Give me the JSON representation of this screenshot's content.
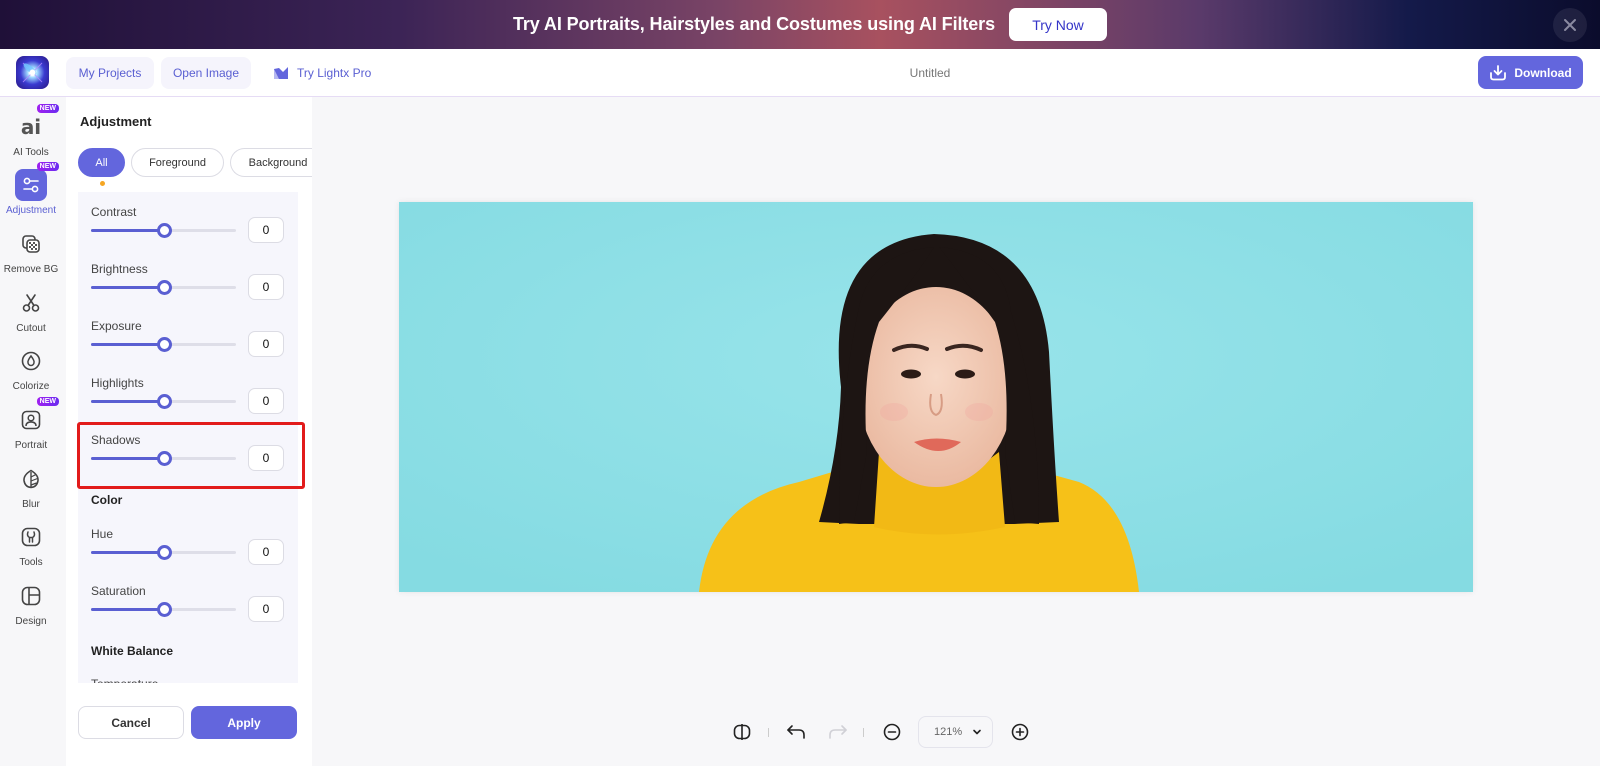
{
  "banner": {
    "text": "Try AI Portraits, Hairstyles and Costumes using AI Filters",
    "cta_label": "Try Now",
    "close_icon": "close-icon"
  },
  "header": {
    "logo": "lightx-logo",
    "my_projects_label": "My Projects",
    "open_image_label": "Open Image",
    "try_pro_label": "Try Lightx Pro",
    "document_title": "Untitled",
    "download_label": "Download"
  },
  "rail": {
    "items": [
      {
        "label": "AI Tools",
        "icon": "ai-icon",
        "badge": "NEW",
        "active": false
      },
      {
        "label": "Adjustment",
        "icon": "adjustment-icon",
        "badge": "NEW",
        "active": true
      },
      {
        "label": "Remove BG",
        "icon": "remove-bg-icon",
        "badge": "",
        "active": false
      },
      {
        "label": "Cutout",
        "icon": "scissors-icon",
        "badge": "",
        "active": false
      },
      {
        "label": "Colorize",
        "icon": "drop-icon",
        "badge": "",
        "active": false
      },
      {
        "label": "Portrait",
        "icon": "portrait-icon",
        "badge": "NEW",
        "active": false
      },
      {
        "label": "Blur",
        "icon": "leaf-icon",
        "badge": "",
        "active": false
      },
      {
        "label": "Tools",
        "icon": "tools-icon",
        "badge": "",
        "active": false
      },
      {
        "label": "Design",
        "icon": "design-icon",
        "badge": "",
        "active": false
      }
    ]
  },
  "panel": {
    "title": "Adjustment",
    "chips": [
      {
        "label": "All",
        "active": true
      },
      {
        "label": "Foreground",
        "active": false
      },
      {
        "label": "Background",
        "active": false
      }
    ],
    "sliders": [
      {
        "label": "Contrast",
        "value": "0",
        "position": 0.5
      },
      {
        "label": "Brightness",
        "value": "0",
        "position": 0.5
      },
      {
        "label": "Exposure",
        "value": "0",
        "position": 0.5
      },
      {
        "label": "Highlights",
        "value": "0",
        "position": 0.5
      },
      {
        "label": "Shadows",
        "value": "0",
        "position": 0.5,
        "highlighted": true
      }
    ],
    "color_section": {
      "heading": "Color",
      "sliders": [
        {
          "label": "Hue",
          "value": "0",
          "position": 0.5
        },
        {
          "label": "Saturation",
          "value": "0",
          "position": 0.5
        }
      ]
    },
    "white_balance_section": {
      "heading": "White Balance",
      "first_item_label": "Temperature"
    },
    "cancel_label": "Cancel",
    "apply_label": "Apply"
  },
  "canvas": {
    "image_description": "Portrait of smiling woman with black bob hair in yellow turtleneck against turquoise background"
  },
  "toolbar": {
    "compare_icon": "compare-icon",
    "undo_icon": "undo-icon",
    "redo_icon": "redo-icon",
    "zoom_out_icon": "zoom-out-icon",
    "zoom_level": "121%",
    "zoom_in_icon": "zoom-in-icon"
  },
  "colors": {
    "accent": "#6366dd",
    "highlight_border": "#e21b1b",
    "chip_dot": "#f5a623",
    "photo_background": "#8fe0e7",
    "sweater": "#f6c118"
  }
}
